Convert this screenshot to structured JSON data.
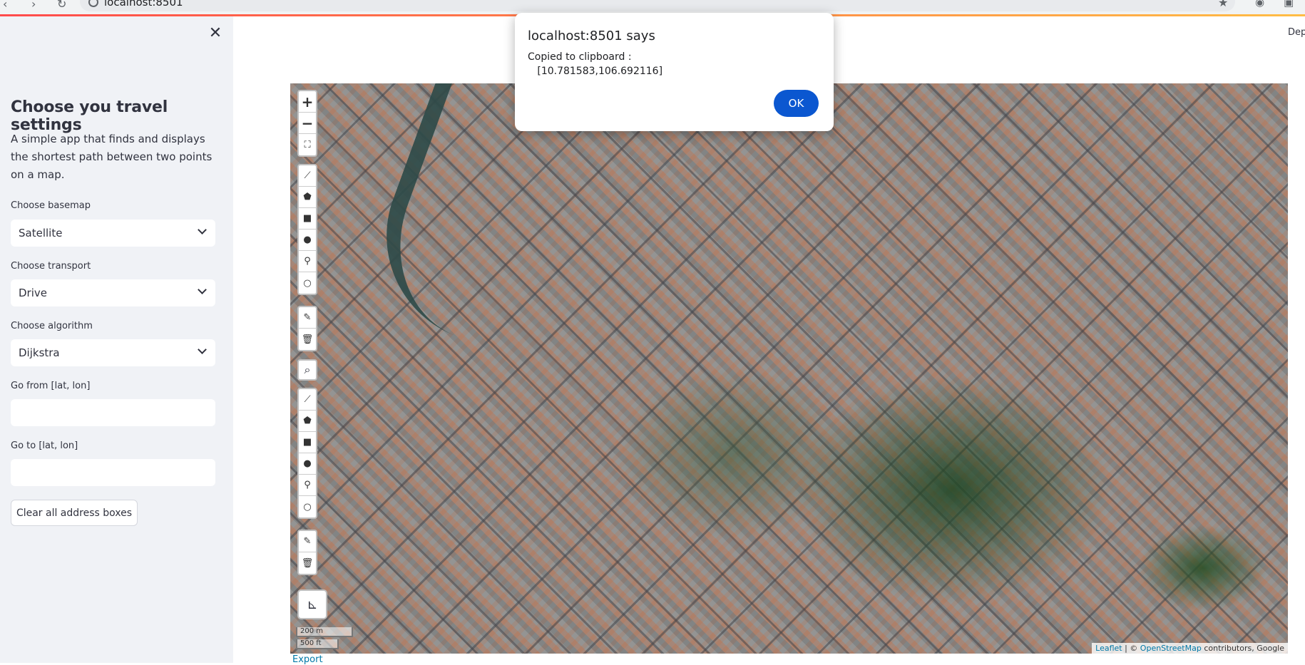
{
  "browser": {
    "url": "localhost:8501"
  },
  "header": {
    "deploy_label": "Dep"
  },
  "sidebar": {
    "title": "Choose you travel settings",
    "description": "A simple app that finds and displays the shortest path between two points on a map.",
    "basemap": {
      "label": "Choose basemap",
      "value": "Satellite"
    },
    "transport": {
      "label": "Choose transport",
      "value": "Drive"
    },
    "algorithm": {
      "label": "Choose algorithm",
      "value": "Dijkstra"
    },
    "go_from": {
      "label": "Go from [lat, lon]",
      "value": ""
    },
    "go_to": {
      "label": "Go to [lat, lon]",
      "value": ""
    },
    "clear_button": "Clear all address boxes"
  },
  "map": {
    "zoom_in": "+",
    "zoom_out": "−",
    "scale_metric": "200 m",
    "scale_imperial": "500 ft",
    "attribution_leaflet": "Leaflet",
    "attribution_sep": " | © ",
    "attribution_osm": "OpenStreetMap",
    "attribution_rest": " contributors, Google",
    "export_label": "Export"
  },
  "dialog": {
    "title": "localhost:8501 says",
    "message": "Copied to clipboard :\n   [10.781583,106.692116]",
    "ok_label": "OK"
  },
  "colors": {
    "accent": "#0b57d0",
    "sidebar_bg": "#f0f2f6",
    "link": "#0078a8"
  }
}
